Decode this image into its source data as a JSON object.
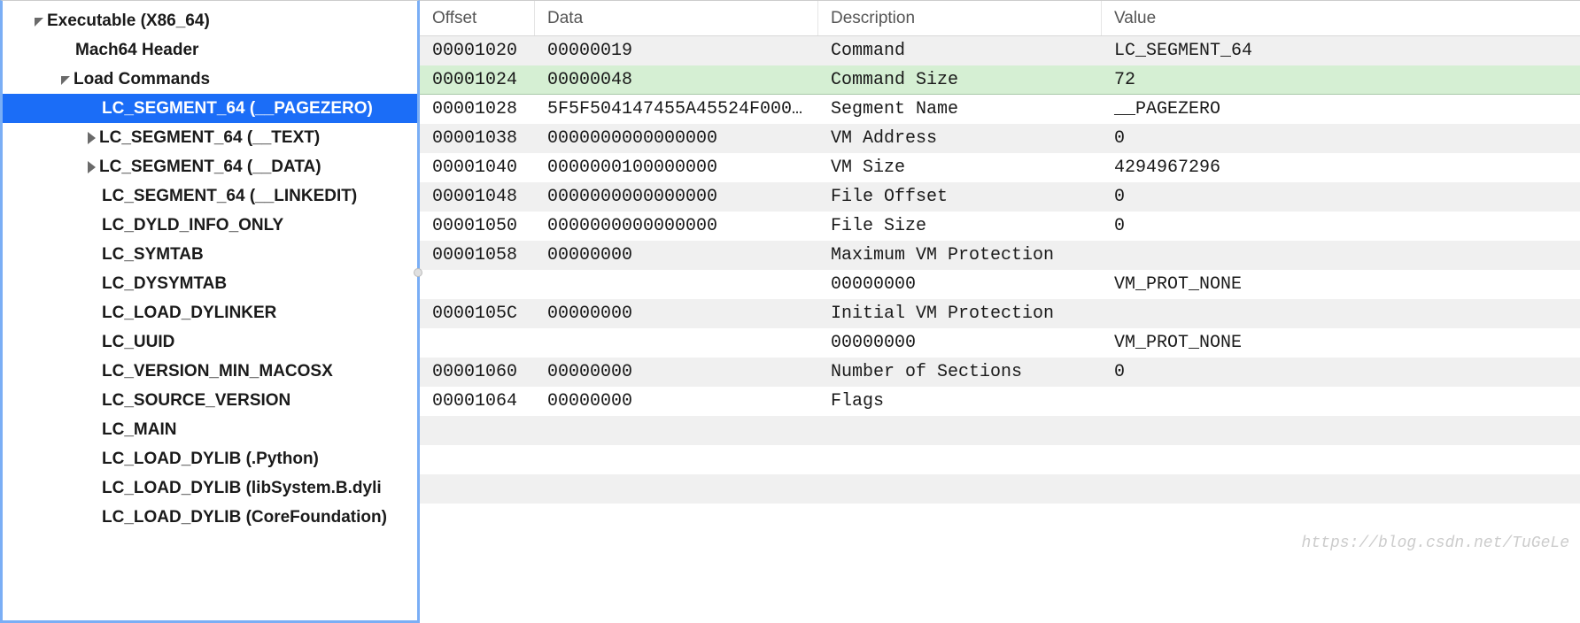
{
  "sidebar": {
    "items": [
      {
        "label": "Executable (X86_64)",
        "indent": 0,
        "disclosure": "open",
        "selected": false
      },
      {
        "label": "Mach64 Header",
        "indent": 1,
        "disclosure": "none",
        "selected": false
      },
      {
        "label": "Load Commands",
        "indent": 1,
        "disclosure": "open",
        "selected": false
      },
      {
        "label": "LC_SEGMENT_64 (__PAGEZERO)",
        "indent": 2,
        "disclosure": "none",
        "selected": true
      },
      {
        "label": "LC_SEGMENT_64 (__TEXT)",
        "indent": 2,
        "disclosure": "closed",
        "selected": false
      },
      {
        "label": "LC_SEGMENT_64 (__DATA)",
        "indent": 2,
        "disclosure": "closed",
        "selected": false
      },
      {
        "label": "LC_SEGMENT_64 (__LINKEDIT)",
        "indent": 2,
        "disclosure": "none",
        "selected": false
      },
      {
        "label": "LC_DYLD_INFO_ONLY",
        "indent": 2,
        "disclosure": "none",
        "selected": false
      },
      {
        "label": "LC_SYMTAB",
        "indent": 2,
        "disclosure": "none",
        "selected": false
      },
      {
        "label": "LC_DYSYMTAB",
        "indent": 2,
        "disclosure": "none",
        "selected": false
      },
      {
        "label": "LC_LOAD_DYLINKER",
        "indent": 2,
        "disclosure": "none",
        "selected": false
      },
      {
        "label": "LC_UUID",
        "indent": 2,
        "disclosure": "none",
        "selected": false
      },
      {
        "label": "LC_VERSION_MIN_MACOSX",
        "indent": 2,
        "disclosure": "none",
        "selected": false
      },
      {
        "label": "LC_SOURCE_VERSION",
        "indent": 2,
        "disclosure": "none",
        "selected": false
      },
      {
        "label": "LC_MAIN",
        "indent": 2,
        "disclosure": "none",
        "selected": false
      },
      {
        "label": "LC_LOAD_DYLIB (.Python)",
        "indent": 2,
        "disclosure": "none",
        "selected": false
      },
      {
        "label": "LC_LOAD_DYLIB (libSystem.B.dyli",
        "indent": 2,
        "disclosure": "none",
        "selected": false
      },
      {
        "label": "LC_LOAD_DYLIB (CoreFoundation)",
        "indent": 2,
        "disclosure": "none",
        "selected": false
      }
    ]
  },
  "table": {
    "headers": {
      "offset": "Offset",
      "data": "Data",
      "description": "Description",
      "value": "Value"
    },
    "rows": [
      {
        "offset": "00001020",
        "data": "00000019",
        "description": "Command",
        "value": "LC_SEGMENT_64",
        "stripe": "a",
        "highlight": false
      },
      {
        "offset": "00001024",
        "data": "00000048",
        "description": "Command Size",
        "value": "72",
        "stripe": "b",
        "highlight": true
      },
      {
        "offset": "00001028",
        "data": "5F5F504147455A45524F000…",
        "description": "Segment Name",
        "value": "__PAGEZERO",
        "stripe": "b",
        "highlight": false
      },
      {
        "offset": "00001038",
        "data": "0000000000000000",
        "description": "VM Address",
        "value": "0",
        "stripe": "a",
        "highlight": false
      },
      {
        "offset": "00001040",
        "data": "0000000100000000",
        "description": "VM Size",
        "value": "4294967296",
        "stripe": "b",
        "highlight": false
      },
      {
        "offset": "00001048",
        "data": "0000000000000000",
        "description": "File Offset",
        "value": "0",
        "stripe": "a",
        "highlight": false
      },
      {
        "offset": "00001050",
        "data": "0000000000000000",
        "description": "File Size",
        "value": "0",
        "stripe": "b",
        "highlight": false
      },
      {
        "offset": "00001058",
        "data": "00000000",
        "description": "Maximum VM Protection",
        "value": "",
        "stripe": "a",
        "highlight": false
      },
      {
        "offset": "",
        "data": "",
        "description": "00000000",
        "value": "VM_PROT_NONE",
        "stripe": "b",
        "highlight": false
      },
      {
        "offset": "0000105C",
        "data": "00000000",
        "description": "Initial VM Protection",
        "value": "",
        "stripe": "a",
        "highlight": false
      },
      {
        "offset": "",
        "data": "",
        "description": "00000000",
        "value": "VM_PROT_NONE",
        "stripe": "b",
        "highlight": false
      },
      {
        "offset": "00001060",
        "data": "00000000",
        "description": "Number of Sections",
        "value": "0",
        "stripe": "a",
        "highlight": false
      },
      {
        "offset": "00001064",
        "data": "00000000",
        "description": "Flags",
        "value": "",
        "stripe": "b",
        "highlight": false
      },
      {
        "offset": "",
        "data": "",
        "description": "",
        "value": "",
        "stripe": "a",
        "highlight": false
      },
      {
        "offset": "",
        "data": "",
        "description": "",
        "value": "",
        "stripe": "b",
        "highlight": false
      },
      {
        "offset": "",
        "data": "",
        "description": "",
        "value": "",
        "stripe": "a",
        "highlight": false
      },
      {
        "offset": "",
        "data": "",
        "description": "",
        "value": "",
        "stripe": "b",
        "highlight": false
      }
    ]
  },
  "watermark": "https://blog.csdn.net/TuGeLe"
}
